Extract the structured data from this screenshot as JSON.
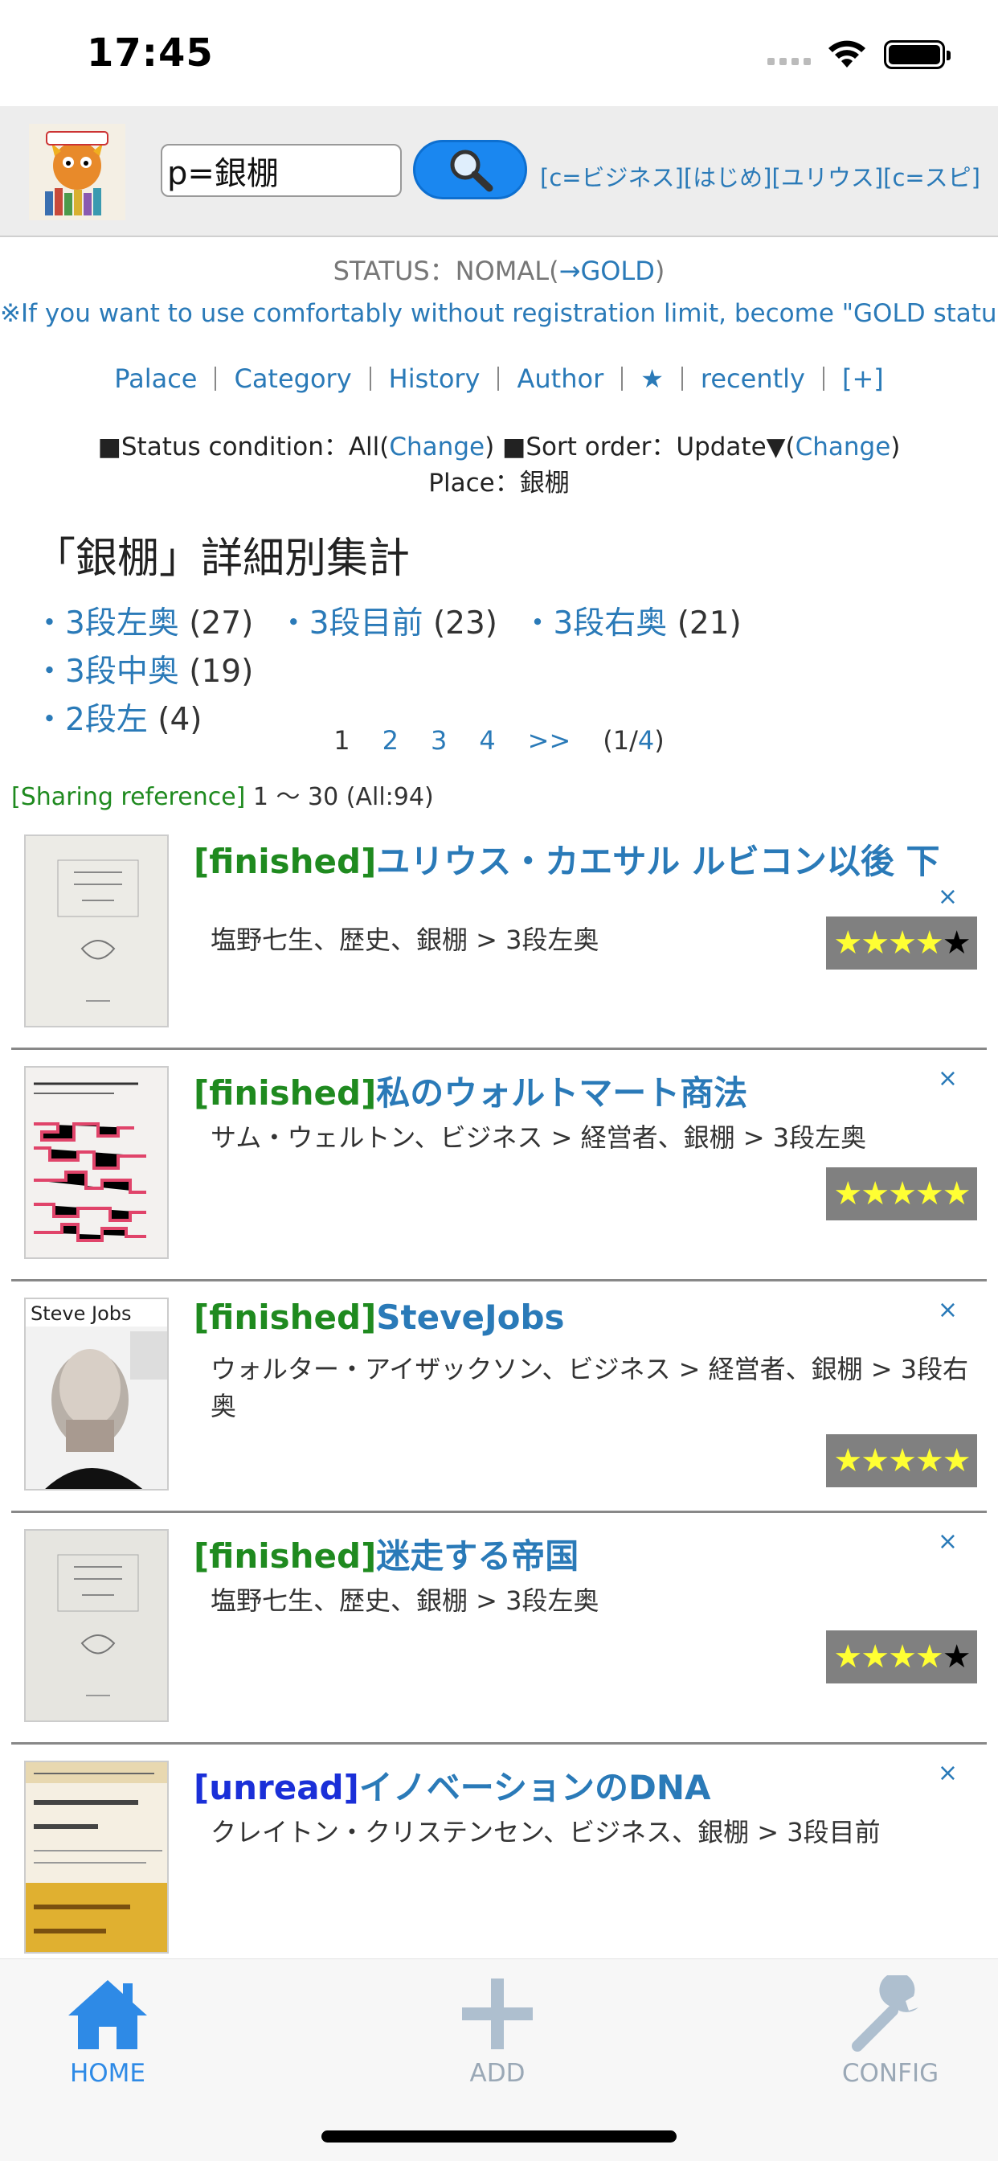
{
  "status_bar": {
    "time": "17:45"
  },
  "header": {
    "search_value": "p=銀棚",
    "quick_links": "[c=ビジネス][はじめ][ユリウス][c=スピ]"
  },
  "status": {
    "prefix": "STATUS：NOMAL(",
    "link": "→GOLD",
    "suffix": ")"
  },
  "gold_note": "※If you want to use comfortably without registration limit, become \"GOLD status\"",
  "nav": [
    "Palace",
    "Category",
    "History",
    "Author",
    "★",
    "recently",
    "[+]"
  ],
  "condition": {
    "status_label": "■Status condition：All(",
    "change": "Change",
    "close_paren": ")",
    "sort_label": " ■Sort order：Update▼(",
    "place": "Place：銀棚"
  },
  "heading": "「銀棚」詳細別集計",
  "tally": [
    {
      "name": "3段左奥",
      "count": "(27)"
    },
    {
      "name": "3段目前",
      "count": "(23)"
    },
    {
      "name": "3段右奥",
      "count": "(21)"
    },
    {
      "name": "3段中奥",
      "count": "(19)"
    },
    {
      "name": "2段左",
      "count": "(4)"
    }
  ],
  "pager": {
    "current": "1",
    "pages": [
      "2",
      "3",
      "4",
      ">>"
    ],
    "summary_open": "(1/",
    "summary_total": "4",
    "summary_close": ")"
  },
  "sharing": {
    "label": "[Sharing reference]",
    "range": " 1 〜 30 (All:94)"
  },
  "books": [
    {
      "tag": "[finished]",
      "title": "ユリウス・カエサル ルビコン以後 下",
      "meta": "塩野七生、歴史、銀棚 > 3段左奥",
      "rating": 4
    },
    {
      "tag": "[finished]",
      "title": "私のウォルトマート商法",
      "meta": "サム・ウェルトン、ビジネス > 経営者、銀棚 > 3段左奥",
      "rating": 5
    },
    {
      "tag": "[finished]",
      "title": "SteveJobs",
      "meta": "ウォルター・アイザックソン、ビジネス > 経営者、銀棚 > 3段右奥",
      "rating": 5
    },
    {
      "tag": "[finished]",
      "title": "迷走する帝国",
      "meta": "塩野七生、歴史、銀棚 > 3段左奥",
      "rating": 4
    },
    {
      "tag": "[unread]",
      "title": "イノベーションのDNA",
      "meta": "クレイトン・クリステンセン、ビジネス、銀棚 > 3段目前",
      "rating": 0
    }
  ],
  "close_symbol": "×",
  "tabbar": {
    "home": "HOME",
    "add": "ADD",
    "config": "CONFIG"
  },
  "colors": {
    "accent": "#2a7ab8",
    "finished": "#1f8a1f",
    "unread": "#1a2fd8",
    "search_button": "#1a87f0"
  }
}
